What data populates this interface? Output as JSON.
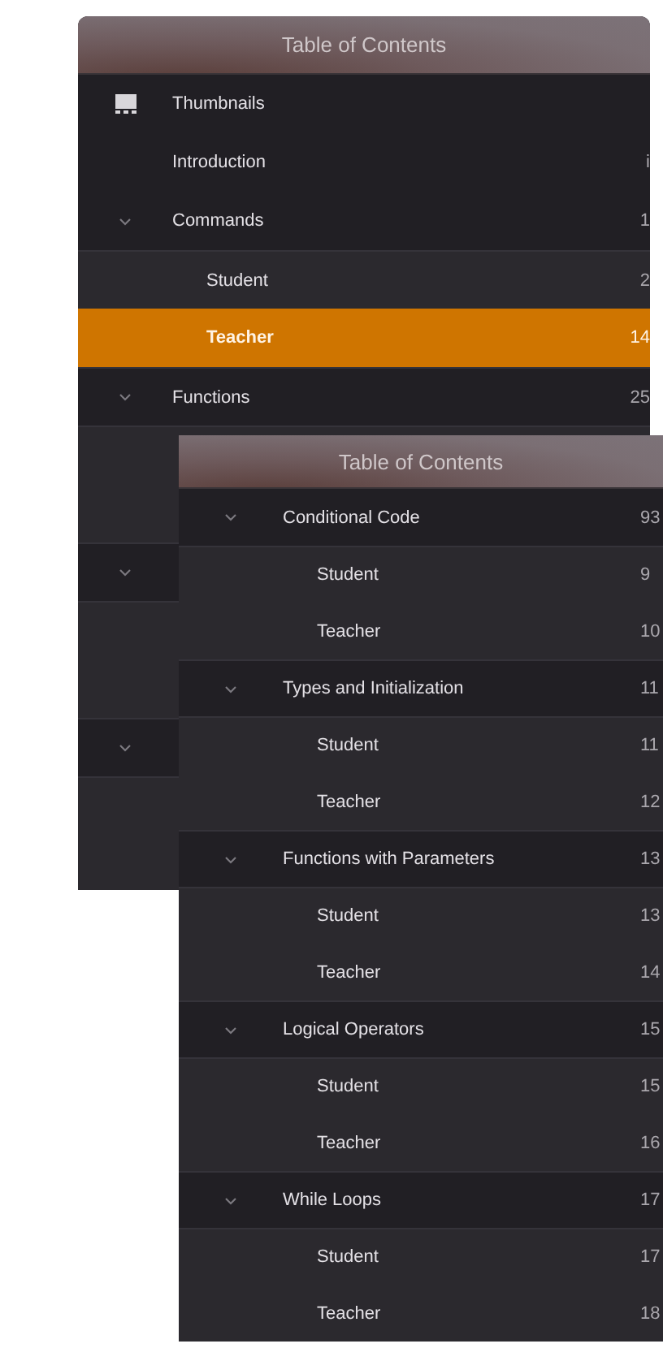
{
  "back_panel": {
    "title": "Table of Contents",
    "items": [
      {
        "kind": "thumbnails",
        "title": "Thumbnails",
        "selected": false
      },
      {
        "kind": "chapter",
        "title": "Introduction",
        "page": "i",
        "selected": false
      },
      {
        "kind": "chapter",
        "title": "Commands",
        "page": "1",
        "expanded": true,
        "selected": false,
        "children": [
          {
            "kind": "entry",
            "title": "Student",
            "page": "2",
            "selected": false
          },
          {
            "kind": "entry",
            "title": "Teacher",
            "page": "14",
            "selected": true
          }
        ]
      },
      {
        "kind": "chapter",
        "title": "Functions",
        "page": "25",
        "expanded": true,
        "selected": false,
        "children": [
          {
            "kind": "covered"
          },
          {
            "kind": "covered"
          }
        ]
      },
      {
        "kind": "covered",
        "expanded": true,
        "children": [
          {
            "kind": "covered"
          },
          {
            "kind": "covered"
          }
        ]
      },
      {
        "kind": "covered",
        "expanded": true,
        "children": [
          {
            "kind": "covered"
          },
          {
            "kind": "covered"
          }
        ]
      }
    ]
  },
  "front_panel": {
    "title": "Table of Contents",
    "items": [
      {
        "kind": "chapter",
        "title": "Conditional Code",
        "page": "93",
        "expanded": true,
        "selected": false,
        "children": [
          {
            "kind": "entry",
            "title": "Student",
            "page": "9",
            "selected": false
          },
          {
            "kind": "entry",
            "title": "Teacher",
            "page": "10",
            "selected": false
          }
        ]
      },
      {
        "kind": "chapter",
        "title": "Types and Initialization",
        "page": "11",
        "expanded": true,
        "selected": false,
        "children": [
          {
            "kind": "entry",
            "title": "Student",
            "page": "11",
            "selected": false
          },
          {
            "kind": "entry",
            "title": "Teacher",
            "page": "12",
            "selected": false
          }
        ]
      },
      {
        "kind": "chapter",
        "title": "Functions with Parameters",
        "page": "13",
        "expanded": true,
        "selected": false,
        "children": [
          {
            "kind": "entry",
            "title": "Student",
            "page": "13",
            "selected": false
          },
          {
            "kind": "entry",
            "title": "Teacher",
            "page": "14",
            "selected": false
          }
        ]
      },
      {
        "kind": "chapter",
        "title": "Logical Operators",
        "page": "15",
        "expanded": true,
        "selected": false,
        "children": [
          {
            "kind": "entry",
            "title": "Student",
            "page": "15",
            "selected": false
          },
          {
            "kind": "entry",
            "title": "Teacher",
            "page": "16",
            "selected": false
          }
        ]
      },
      {
        "kind": "chapter",
        "title": "While Loops",
        "page": "17",
        "expanded": true,
        "selected": false,
        "children": [
          {
            "kind": "entry",
            "title": "Student",
            "page": "17",
            "selected": false
          },
          {
            "kind": "entry",
            "title": "Teacher",
            "page": "18",
            "selected": false
          }
        ]
      }
    ]
  }
}
